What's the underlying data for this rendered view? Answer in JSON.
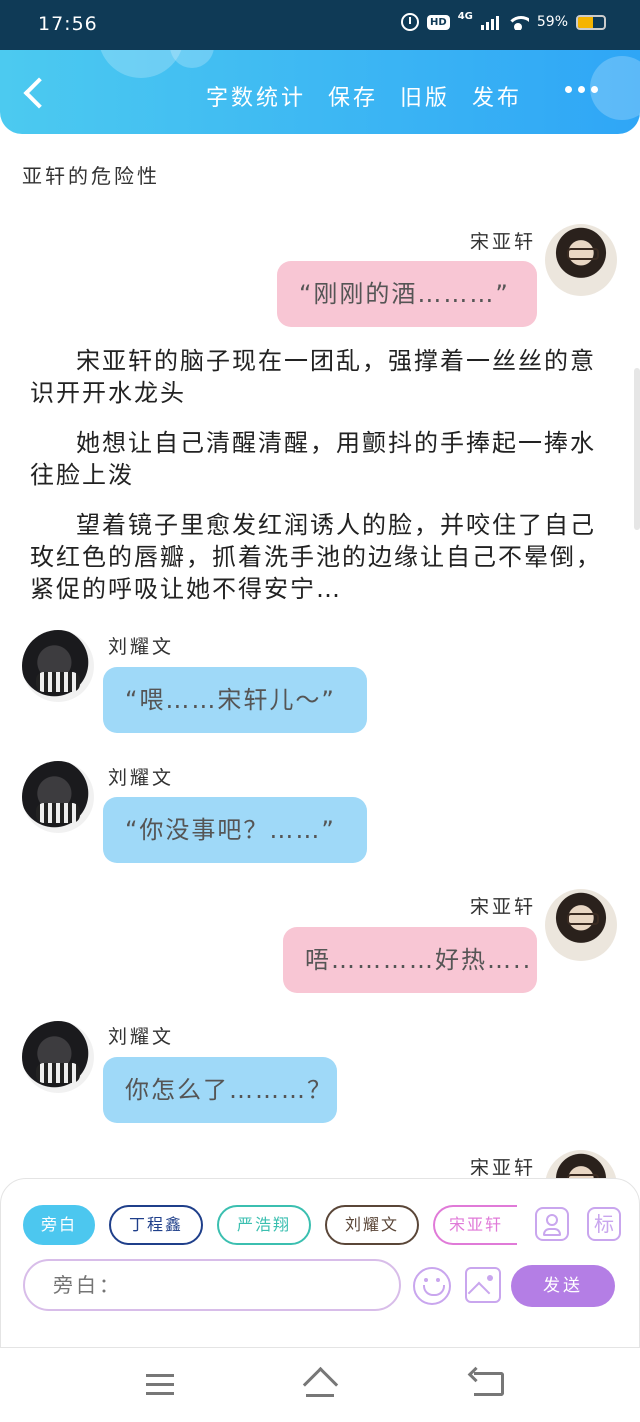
{
  "status_bar": {
    "time": "17:56",
    "network": "4G",
    "battery": "59%",
    "battery_level": 0.59,
    "hd_label": "HD"
  },
  "header": {
    "menu": [
      "字数统计",
      "保存",
      "旧版",
      "发布"
    ]
  },
  "document_title": "亚轩的危险性",
  "messages": [
    {
      "type": "dialog",
      "side": "right",
      "sender": "宋亚轩",
      "text": "“刚刚的酒………”"
    },
    {
      "type": "narration",
      "text": "宋亚轩的脑子现在一团乱，强撑着一丝丝的意识开开水龙头"
    },
    {
      "type": "narration",
      "text": "她想让自己清醒清醒，用颤抖的手捧起一捧水往脸上泼"
    },
    {
      "type": "narration",
      "text": "望着镜子里愈发红润诱人的脸，并咬住了自己玫红色的唇瓣，抓着洗手池的边缘让自己不晕倒，紧促的呼吸让她不得安宁…"
    },
    {
      "type": "dialog",
      "side": "left",
      "sender": "刘耀文",
      "text": "“喂……宋轩儿～”"
    },
    {
      "type": "dialog",
      "side": "left",
      "sender": "刘耀文",
      "text": "“你没事吧？……”"
    },
    {
      "type": "dialog",
      "side": "right",
      "sender": "宋亚轩",
      "text": "唔…………好热….."
    },
    {
      "type": "dialog",
      "side": "left",
      "sender": "刘耀文",
      "text": "你怎么了………？"
    },
    {
      "type": "dialog",
      "side": "right",
      "sender": "宋亚轩",
      "text": ""
    }
  ],
  "roles": [
    {
      "label": "旁白",
      "color": "#4cc7ef",
      "active": true
    },
    {
      "label": "丁程鑫",
      "color": "#1f3f8a",
      "active": false
    },
    {
      "label": "严浩翔",
      "color": "#3bbfb0",
      "active": false
    },
    {
      "label": "刘耀文",
      "color": "#5a4638",
      "active": false
    },
    {
      "label": "宋亚轩",
      "color": "#e07ad8",
      "active": false
    }
  ],
  "tag_button_label": "标",
  "input": {
    "placeholder": "旁白："
  },
  "send_label": "发送"
}
